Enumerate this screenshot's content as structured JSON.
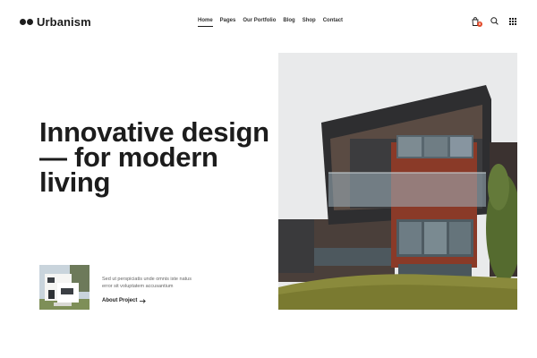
{
  "brand": {
    "name": "Urbanism"
  },
  "nav": {
    "items": [
      {
        "label": "Home",
        "active": true
      },
      {
        "label": "Pages"
      },
      {
        "label": "Our Portfolio"
      },
      {
        "label": "Blog"
      },
      {
        "label": "Shop"
      },
      {
        "label": "Contact"
      }
    ]
  },
  "actions": {
    "cart_icon": "shopping-bag-icon",
    "cart_count": "0",
    "search_icon": "search-icon",
    "menu_icon": "grid-menu-icon"
  },
  "hero": {
    "title": "Innovative design — for modern living"
  },
  "project": {
    "description": "Sed ut perspiciatis unde omnis iste natus error sit voluptatem accusantium",
    "link_label": "About Project",
    "link_icon": "arrow-right-icon"
  },
  "colors": {
    "text": "#1c1c1c",
    "accent": "#e24a2a",
    "background": "#ffffff"
  }
}
